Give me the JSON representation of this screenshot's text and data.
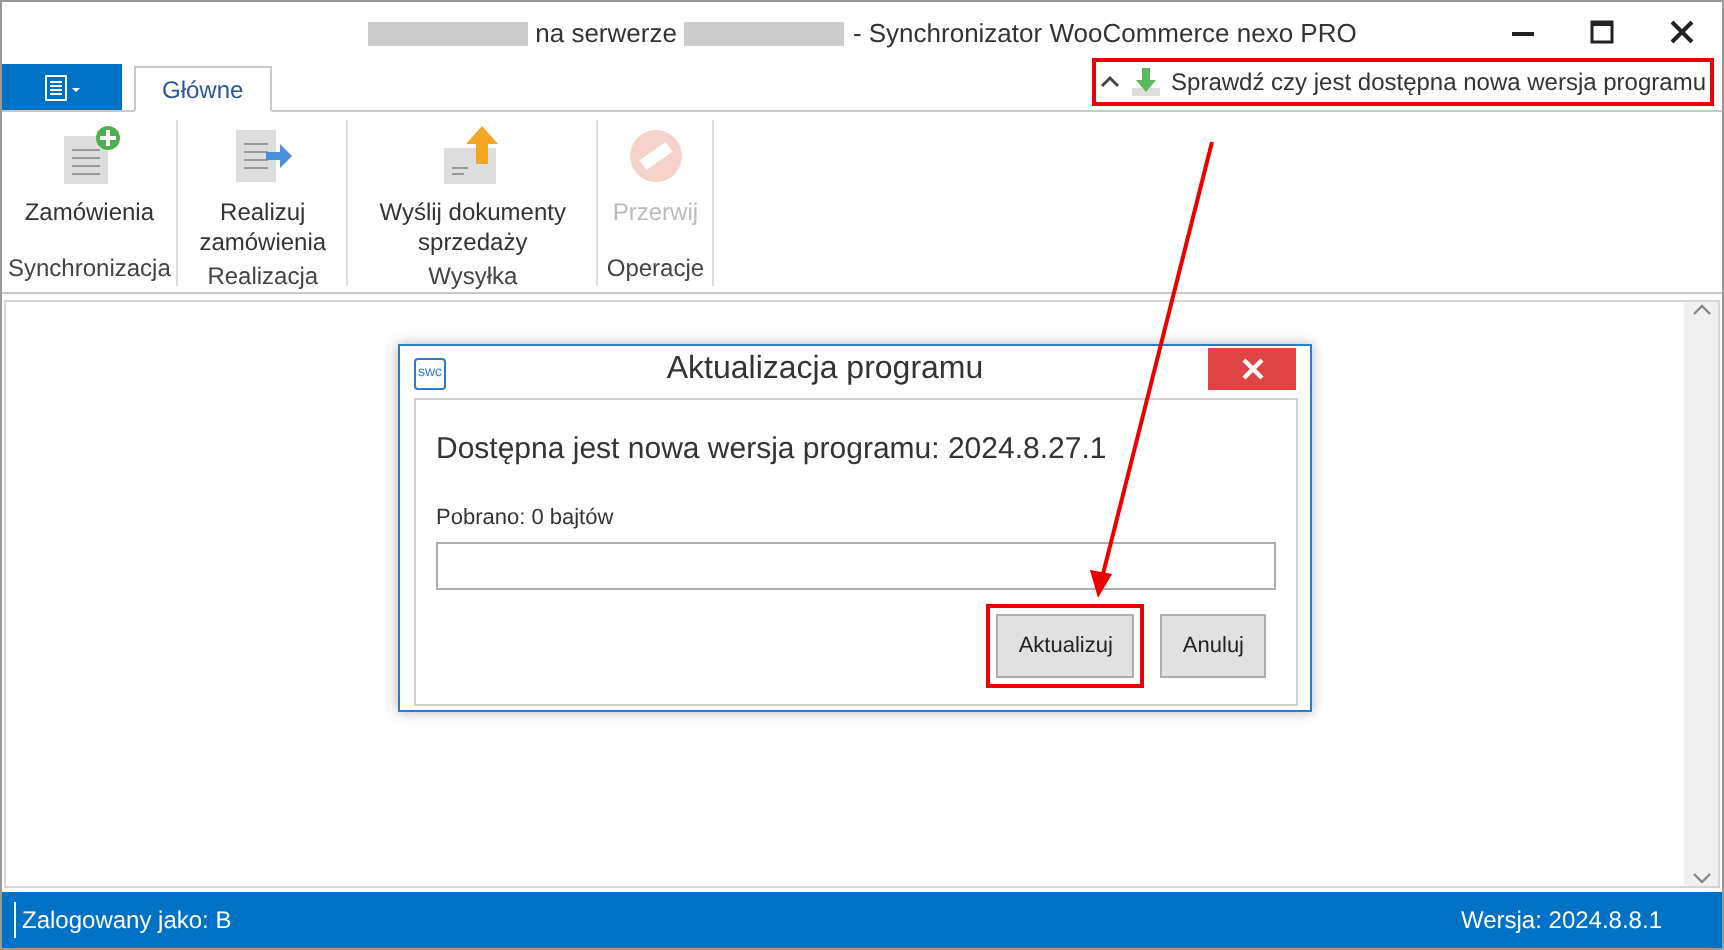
{
  "window": {
    "title_parts": [
      {
        "kind": "redacted"
      },
      {
        "kind": "text",
        "text": "na serwerze"
      },
      {
        "kind": "redacted"
      },
      {
        "kind": "text",
        "text": "- Synchronizator WooCommerce nexo PRO"
      }
    ]
  },
  "tabs": [
    {
      "label": "Główne",
      "selected": true
    }
  ],
  "update_link": {
    "text": "Sprawdź czy jest dostępna nowa wersja programu",
    "highlighted": true
  },
  "ribbon_groups": [
    {
      "label": "Synchronizacja",
      "buttons": [
        {
          "label": "Zamówienia",
          "disabled": false
        }
      ]
    },
    {
      "label": "Realizacja",
      "buttons": [
        {
          "label": "Realizuj zamówienia",
          "disabled": false
        }
      ]
    },
    {
      "label": "Wysyłka",
      "buttons": [
        {
          "label": "Wyślij dokumenty sprzedaży",
          "disabled": false
        }
      ]
    },
    {
      "label": "Operacje",
      "buttons": [
        {
          "label": "Przerwij",
          "disabled": true
        }
      ]
    }
  ],
  "dialog": {
    "icon_text": "swc",
    "title": "Aktualizacja programu",
    "message": "Dostępna jest nowa wersja programu: 2024.8.27.1",
    "progress_label": "Pobrano: 0 bajtów",
    "progress": {
      "level": 0
    },
    "buttons": [
      {
        "label": "Aktualizuj",
        "highlighted": true
      },
      {
        "label": "Anuluj",
        "highlighted": false
      }
    ]
  },
  "status_bar": {
    "left": "Zalogowany jako: B",
    "right": "Wersja: 2024.8.8.1"
  }
}
